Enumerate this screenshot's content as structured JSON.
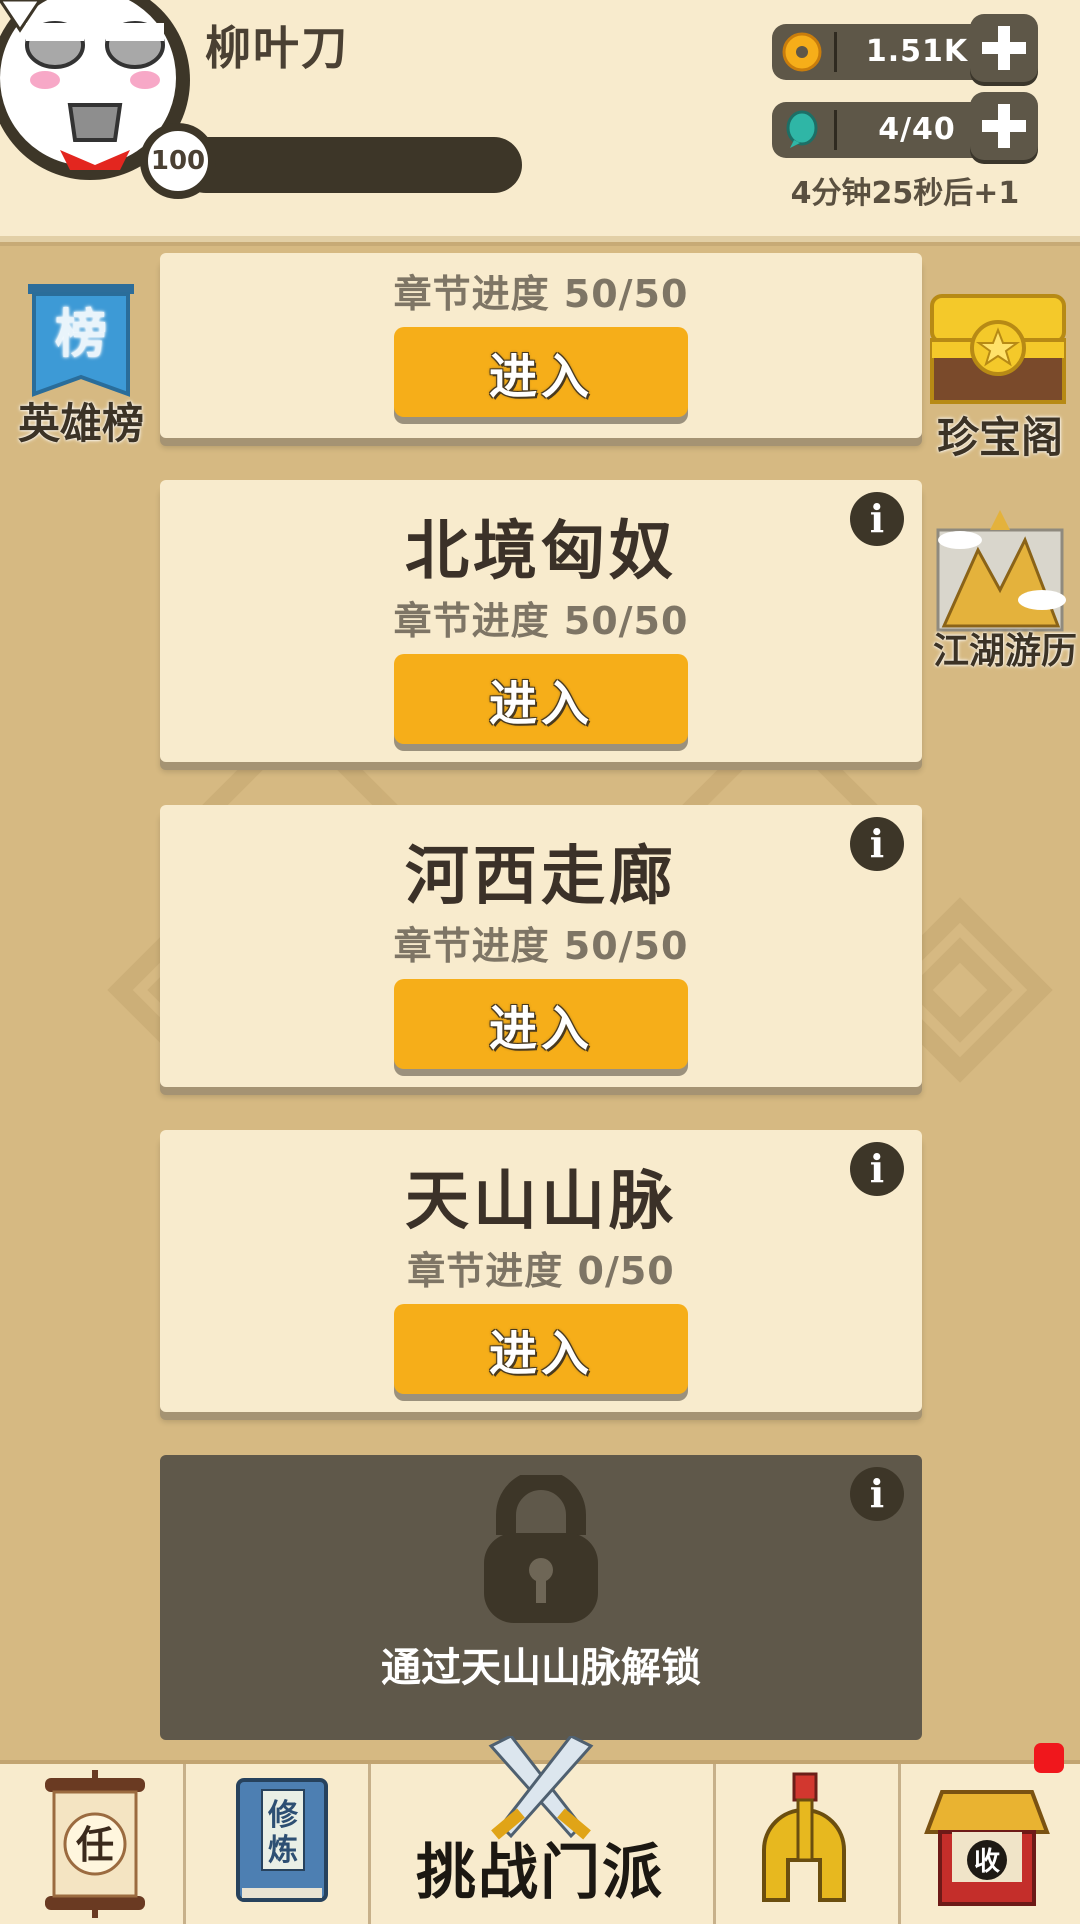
{
  "header": {
    "player_name": "柳叶刀",
    "level": "100",
    "coins": "1.51K",
    "energy": "4/40",
    "energy_timer": "4分钟25秒后+1"
  },
  "side_left": {
    "hero_rank_label": "英雄榜",
    "hero_rank_glyph": "榜"
  },
  "side_right": {
    "treasure_label": "珍宝阁",
    "journey_label": "江湖游历"
  },
  "chapters": [
    {
      "title": "",
      "progress": "章节进度 50/50",
      "button": "进入"
    },
    {
      "title": "北境匈奴",
      "progress": "章节进度 50/50",
      "button": "进入"
    },
    {
      "title": "河西走廊",
      "progress": "章节进度 50/50",
      "button": "进入"
    },
    {
      "title": "天山山脉",
      "progress": "章节进度 0/50",
      "button": "进入"
    }
  ],
  "locked_chapter": {
    "unlock_text": "通过天山山脉解锁"
  },
  "info_glyph": "i",
  "nav": {
    "task_glyph": "任",
    "training_glyph1": "修",
    "training_glyph2": "炼",
    "center_label": "挑战门派",
    "collect_glyph": "收"
  },
  "colors": {
    "background": "#d6b982",
    "card": "#f8ebcd",
    "enter_button": "#f6ae19",
    "locked_card": "#5f584a",
    "notification": "#f0171c"
  },
  "icons": [
    "avatar",
    "coin-icon",
    "energy-gem-icon",
    "plus-icon",
    "hero-rank-banner-icon",
    "treasure-chest-icon",
    "mountain-scroll-icon",
    "info-icon",
    "lock-icon",
    "task-scroll-icon",
    "training-book-icon",
    "crossed-swords-icon",
    "helmet-icon",
    "shop-icon"
  ]
}
